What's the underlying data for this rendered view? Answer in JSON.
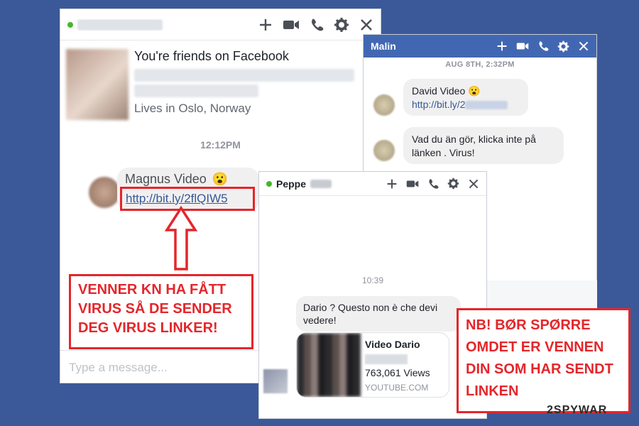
{
  "window1": {
    "friends_text": "You're friends on Facebook",
    "lives_text": "Lives in Oslo, Norway",
    "timestamp": "12:12PM",
    "message_name": "Magnus Video",
    "emoji": "😮",
    "message_link": "http://bit.ly/2flQIW5",
    "input_placeholder": "Type a message..."
  },
  "window2": {
    "title": "Malin",
    "date": "AUG 8TH, 2:32PM",
    "msg1_name": "David Video",
    "emoji": "😮",
    "msg1_link": "http://bit.ly/2",
    "msg2_text": "Vad du än gör, klicka inte på länken . Virus!"
  },
  "window3": {
    "title": "Peppe",
    "timestamp": "10:39",
    "message_text": "Dario ? Questo non è che devi vedere!",
    "video_title": "Video Dario",
    "video_views": "763,061 Views",
    "video_source": "YOUTUBE.COM"
  },
  "warnings": {
    "warning1": "VENNER KN HA FÅTT VIRUS SÅ DE SENDER DEG VIRUS LINKER!",
    "warning2": "NB! BØR SPØRRE OMDET ER VENNEN DIN SOM HAR SENDT LINKEN"
  },
  "watermark": "2SPYWAR",
  "colors": {
    "background": "#3b5998",
    "messenger_blue": "#4267b2",
    "warning_red": "#e4262b",
    "online_green": "#42b72a"
  },
  "icons": [
    "plus-icon",
    "video-camera-icon",
    "phone-icon",
    "gear-icon",
    "close-icon"
  ]
}
